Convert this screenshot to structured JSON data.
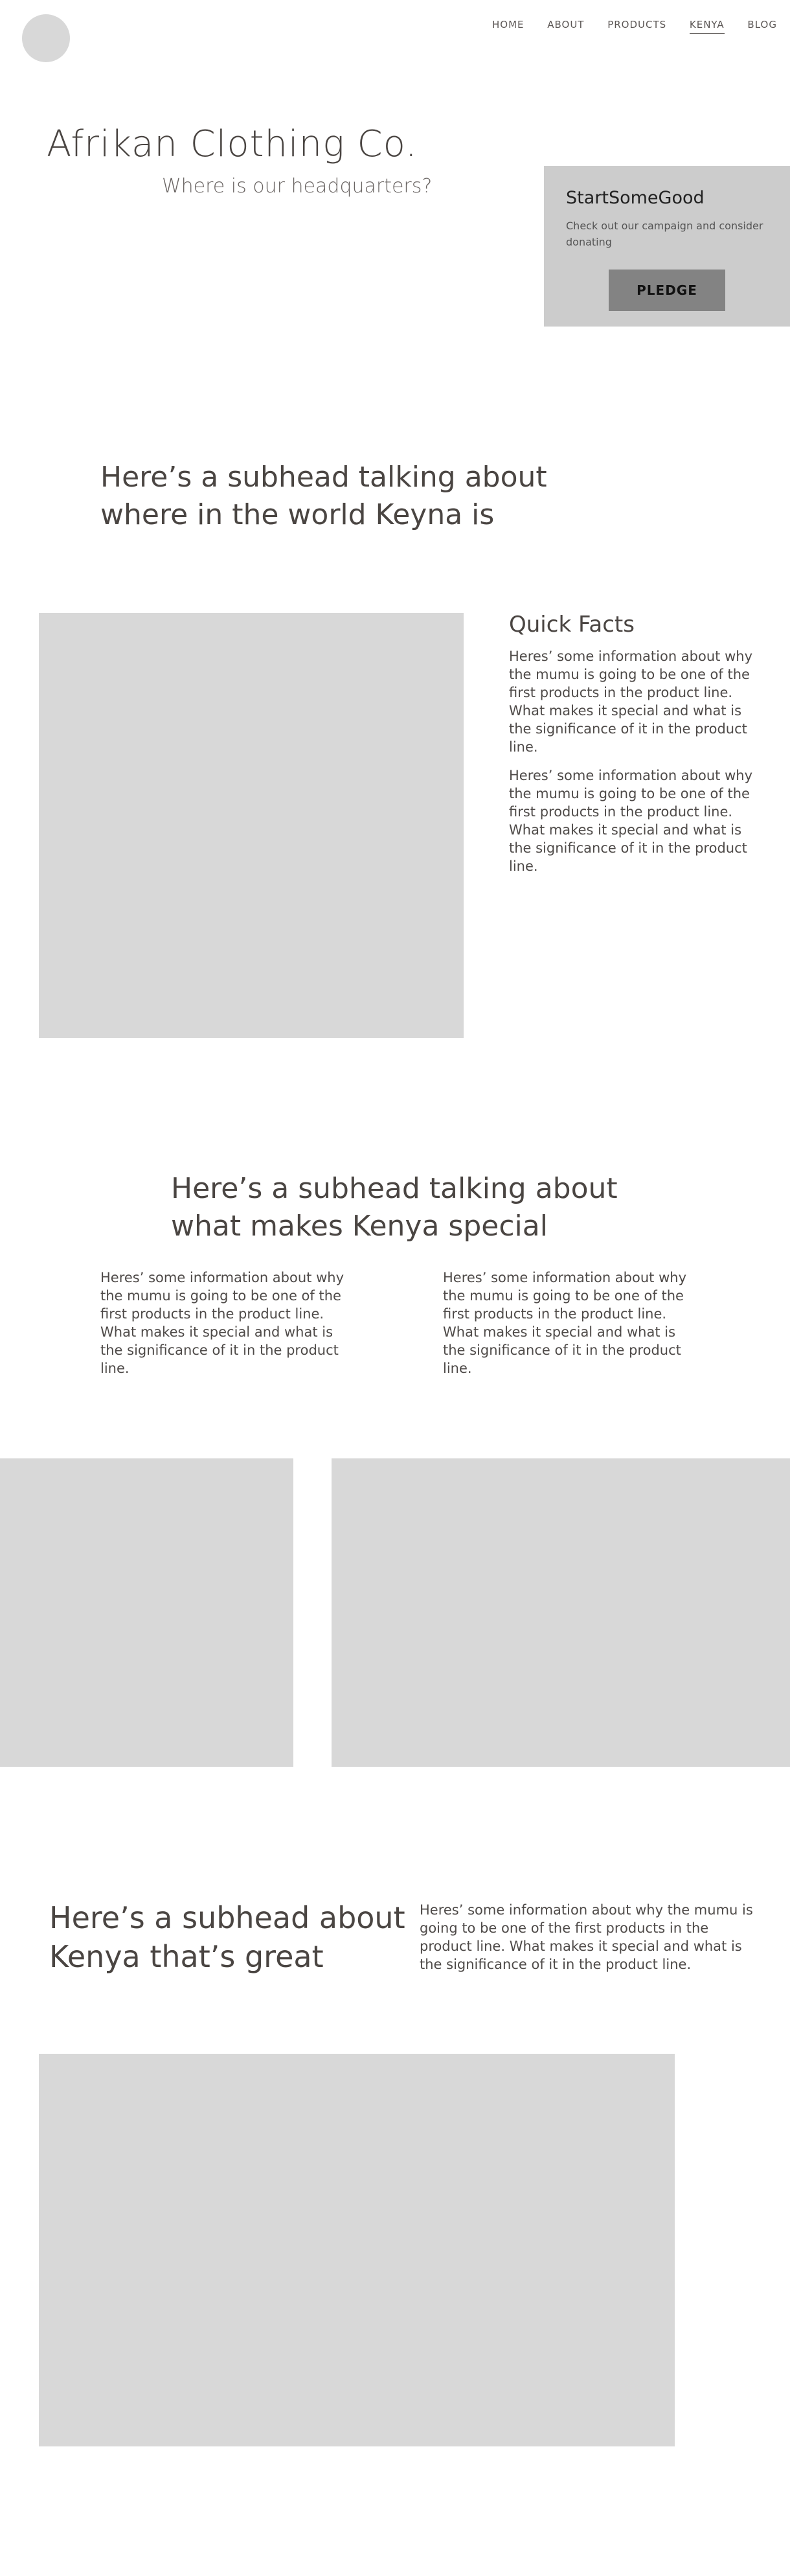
{
  "header": {
    "logo_alt": "",
    "nav": [
      {
        "label": "HOME"
      },
      {
        "label": "ABOUT"
      },
      {
        "label": "PRODUCTS"
      },
      {
        "label": "KENYA",
        "active": true
      },
      {
        "label": "BLOG"
      }
    ]
  },
  "hero": {
    "title": "Afrikan Clothing Co.",
    "subtitle": "Where is our headquarters?"
  },
  "campaign": {
    "title": "StartSomeGood",
    "text": "Check out our campaign and consider donating",
    "button": "PLEDGE"
  },
  "section1": {
    "subhead": "Here’s a subhead talking about where in the world Keyna is"
  },
  "quick_facts": {
    "title": "Quick Facts",
    "paragraphs": [
      "Heres’ some information about why the mumu is going to be one of the first products in the product line. What makes it special and what is the significance of it in the product line.",
      "Heres’ some information about why the mumu is going to be one of the first products in the product line. What makes it special and what is the significance of it in the product line."
    ]
  },
  "section2": {
    "subhead": "Here’s a subhead talking about what makes Kenya special",
    "columns": [
      "Heres’ some information about why the mumu is going to be one of the first products in the product line. What makes it special and what is the significance of it in the product line.",
      "Heres’ some information about why the mumu is going to be one of the first products in the product line. What makes it special and what is the significance of it in the product line."
    ]
  },
  "section3": {
    "subhead": "Here’s a subhead about Kenya that’s great",
    "text": "Heres’ some information about why the mumu is going to be one of the first products in the product line. What makes it special and what is the significance of it in the product line."
  },
  "colors": {
    "placeholder": "#d8d8d8",
    "campaign_bg": "#cccccc",
    "button_bg": "#838383",
    "text": "#4a4542"
  }
}
